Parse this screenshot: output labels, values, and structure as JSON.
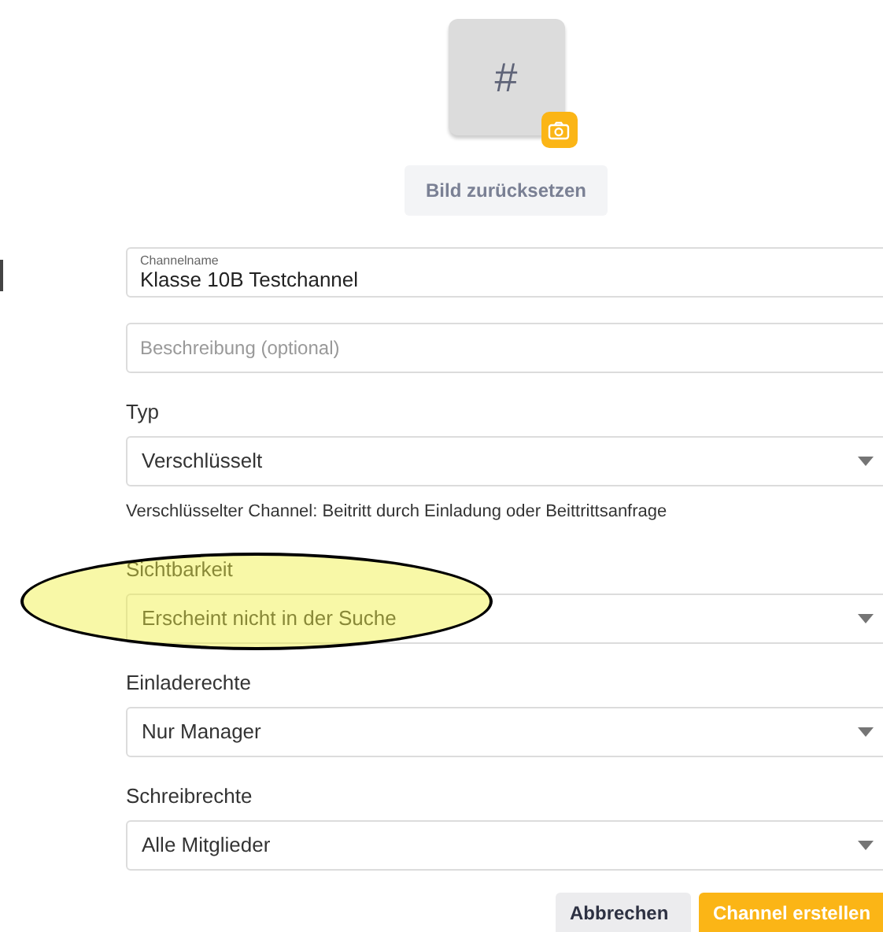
{
  "avatar": {
    "symbol": "#"
  },
  "reset_button": {
    "label": "Bild zurücksetzen"
  },
  "fields": [
    {
      "label": "Channelname",
      "value": "Klasse 10B Testchannel"
    },
    {
      "placeholder": "Beschreibung (optional)"
    }
  ],
  "selects": [
    {
      "label": "Typ",
      "value": "Verschlüsselt",
      "hint": "Verschlüsselter Channel: Beitritt durch Einladung oder Beittrittsanfrage"
    },
    {
      "label": "Sichtbarkeit",
      "value": "Erscheint nicht in der Suche"
    },
    {
      "label": "Einladerechte",
      "value": "Nur Manager"
    },
    {
      "label": "Schreibrechte",
      "value": "Alle Mitglieder"
    }
  ],
  "buttons": [
    {
      "label": "Abbrechen",
      "kind": "secondary"
    },
    {
      "label": "Channel erstellen",
      "kind": "primary"
    }
  ]
}
